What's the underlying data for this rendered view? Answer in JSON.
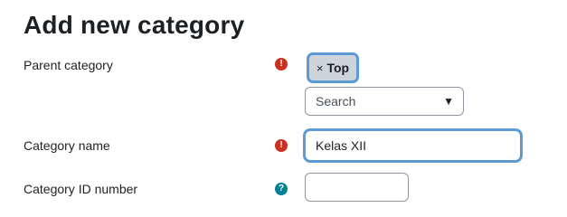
{
  "page": {
    "title": "Add new category"
  },
  "form": {
    "parent_category": {
      "label": "Parent category",
      "required_icon": "exclamation-circle",
      "selected_chip": {
        "remove_symbol": "×",
        "label": "Top"
      },
      "search_placeholder": "Search",
      "dropdown_icon": "▼"
    },
    "category_name": {
      "label": "Category name",
      "required_icon": "exclamation-circle",
      "value": "Kelas XII"
    },
    "category_id_number": {
      "label": "Category ID number",
      "help_icon": "question-circle",
      "value": ""
    }
  },
  "colors": {
    "required": "#ca3120",
    "help": "#008196",
    "focus": "#5b9bd5"
  }
}
